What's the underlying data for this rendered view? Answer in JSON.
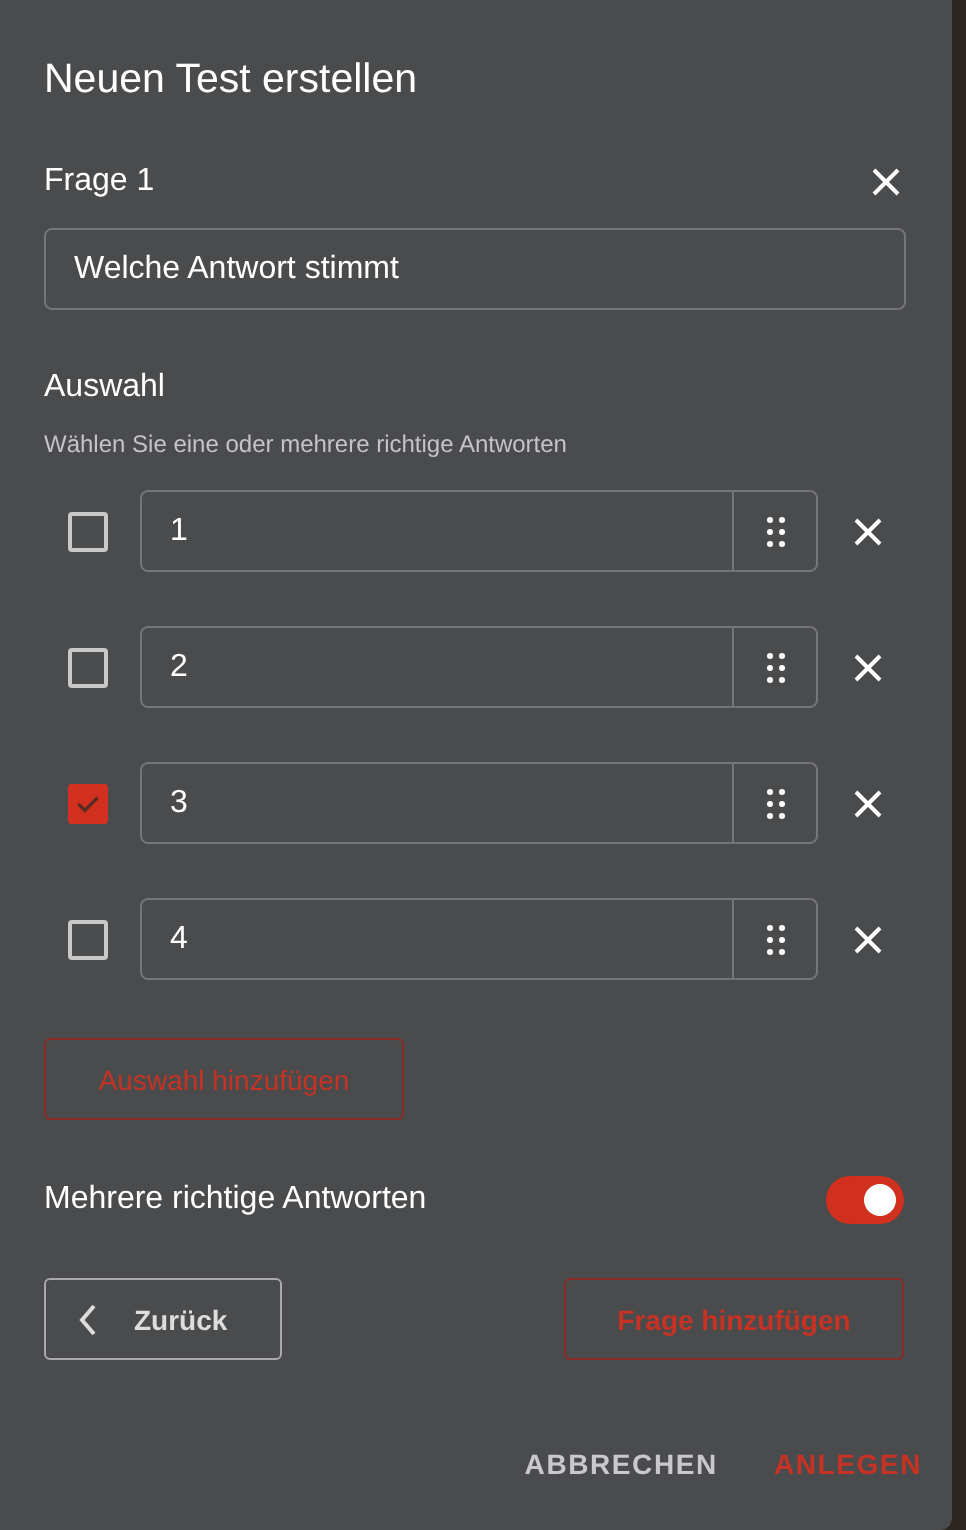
{
  "dialog": {
    "title": "Neuen Test erstellen"
  },
  "question": {
    "label": "Frage 1",
    "value": "Welche Antwort stimmt"
  },
  "choices_section": {
    "label": "Auswahl",
    "hint": "Wählen Sie eine oder mehrere richtige Antworten"
  },
  "choices": [
    {
      "value": "1",
      "checked": false
    },
    {
      "value": "2",
      "checked": false
    },
    {
      "value": "3",
      "checked": true
    },
    {
      "value": "4",
      "checked": false
    }
  ],
  "add_choice_button": "Auswahl hinzufügen",
  "multiple_answers": {
    "label": "Mehrere richtige Antworten",
    "on": true
  },
  "back_button": "Zurück",
  "add_question_button": "Frage hinzufügen",
  "footer_buttons": [
    {
      "label": "ABBRECHEN",
      "kind": "secondary"
    },
    {
      "label": "ANLEGEN",
      "kind": "primary"
    }
  ]
}
